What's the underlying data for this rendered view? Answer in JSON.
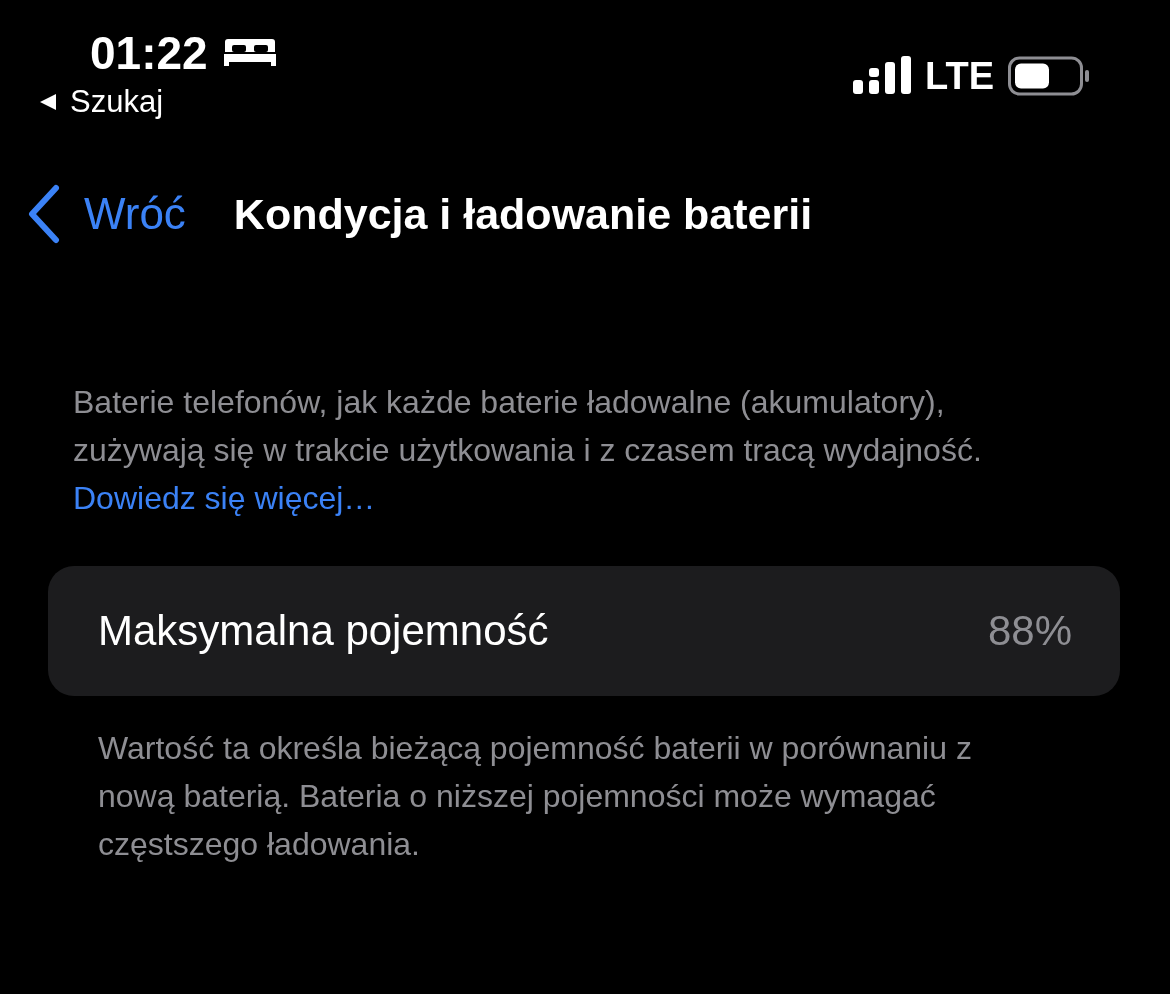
{
  "status_bar": {
    "time": "01:22",
    "back_app": "Szukaj",
    "network": "LTE"
  },
  "nav": {
    "back": "Wróć",
    "title": "Kondycja i ładowanie baterii"
  },
  "intro": {
    "text": "Baterie telefonów, jak każde baterie ładowalne (akumulatory), zużywają się w trakcie użytkowania i z czasem tracą wydajność.",
    "link": "Dowiedz się więcej…"
  },
  "capacity": {
    "label": "Maksymalna pojemność",
    "value": "88%"
  },
  "footer": "Wartość ta określa bieżącą pojemność baterii w porównaniu z nową baterią. Bateria o niższej pojemności może wymagać częstszego ładowania."
}
